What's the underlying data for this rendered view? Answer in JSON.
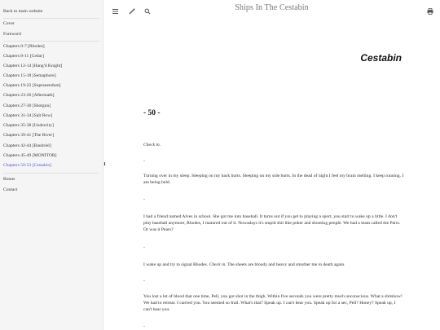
{
  "sidebar": {
    "back_link": "Back to main website",
    "cover": "Cover",
    "foreword": "Foreword",
    "chapters": [
      "Chapters 0-7 [Rhodes]",
      "Chapters 8-11 [Cedar]",
      "Chapters 12-14 [Hang'd Knight]",
      "Chapters 15-18 [Semaphore]",
      "Chapters 19-22 [Supranendum]",
      "Chapters 23-26 [Aftermath]",
      "Chapters 27-30 [Shotgun]",
      "Chapters 31-34 [Salt Row]",
      "Chapters 35-38 [Undercity]",
      "Chapters 39-41 [The River]",
      "Chapters 42-44 [Bauhriel]",
      "Chapters 45-49 [MONITOR]",
      "Chapters 50-53 [Cestabin]"
    ],
    "bonus": "Bonus",
    "contact": "Contact"
  },
  "toolbar": {
    "menu_icon": "menu-icon",
    "theme_icon": "brush-icon",
    "search_icon": "search-icon",
    "print_icon": "print-icon"
  },
  "book_title": "Ships In The Cestabin",
  "part_title": "Cestabin",
  "chapter_number": "- 50 -",
  "page_marker": "1",
  "content": {
    "p1": "Check in.",
    "sep1": "-",
    "p2": "Turning over in my sleep. Sleeping on my back hurts. Sleeping on my side hurts. In the dead of night I feel my brain melting. I keep running. I am being held.",
    "sep2": "-",
    "p3": "I had a friend named Alves in school. She got me into baseball. It turns out if you get to playing a sport, you start to wake up a little. I don't play baseball anymore, Rhodes, I matured out of it. Nowadays it's stupid shit like poker and shooting people. We had a team called the Pairs. Or was it Pears?",
    "sep3": "-",
    "p4_a": "I wake up and try to signal Rhodes.",
    "p4_em": "Check in.",
    "p4_b": "The sheets are bloody and heavy and smother me to death again.",
    "sep4": "-",
    "p5": "You lost a lot of blood that one time, Pell, you got shot in the thigh. Within five seconds you were pretty much unconscious. What a shitshow! We had to retreat. I carried you. You seemed so frail. What's that? Speak up. I can't hear you. Speak up for a sec, Pell? Honey? Speak up, I can't hear you.",
    "sep5": "-"
  },
  "colors": {
    "sidebar_bg": "#f5f5f5",
    "active_link": "#5a50d8"
  }
}
